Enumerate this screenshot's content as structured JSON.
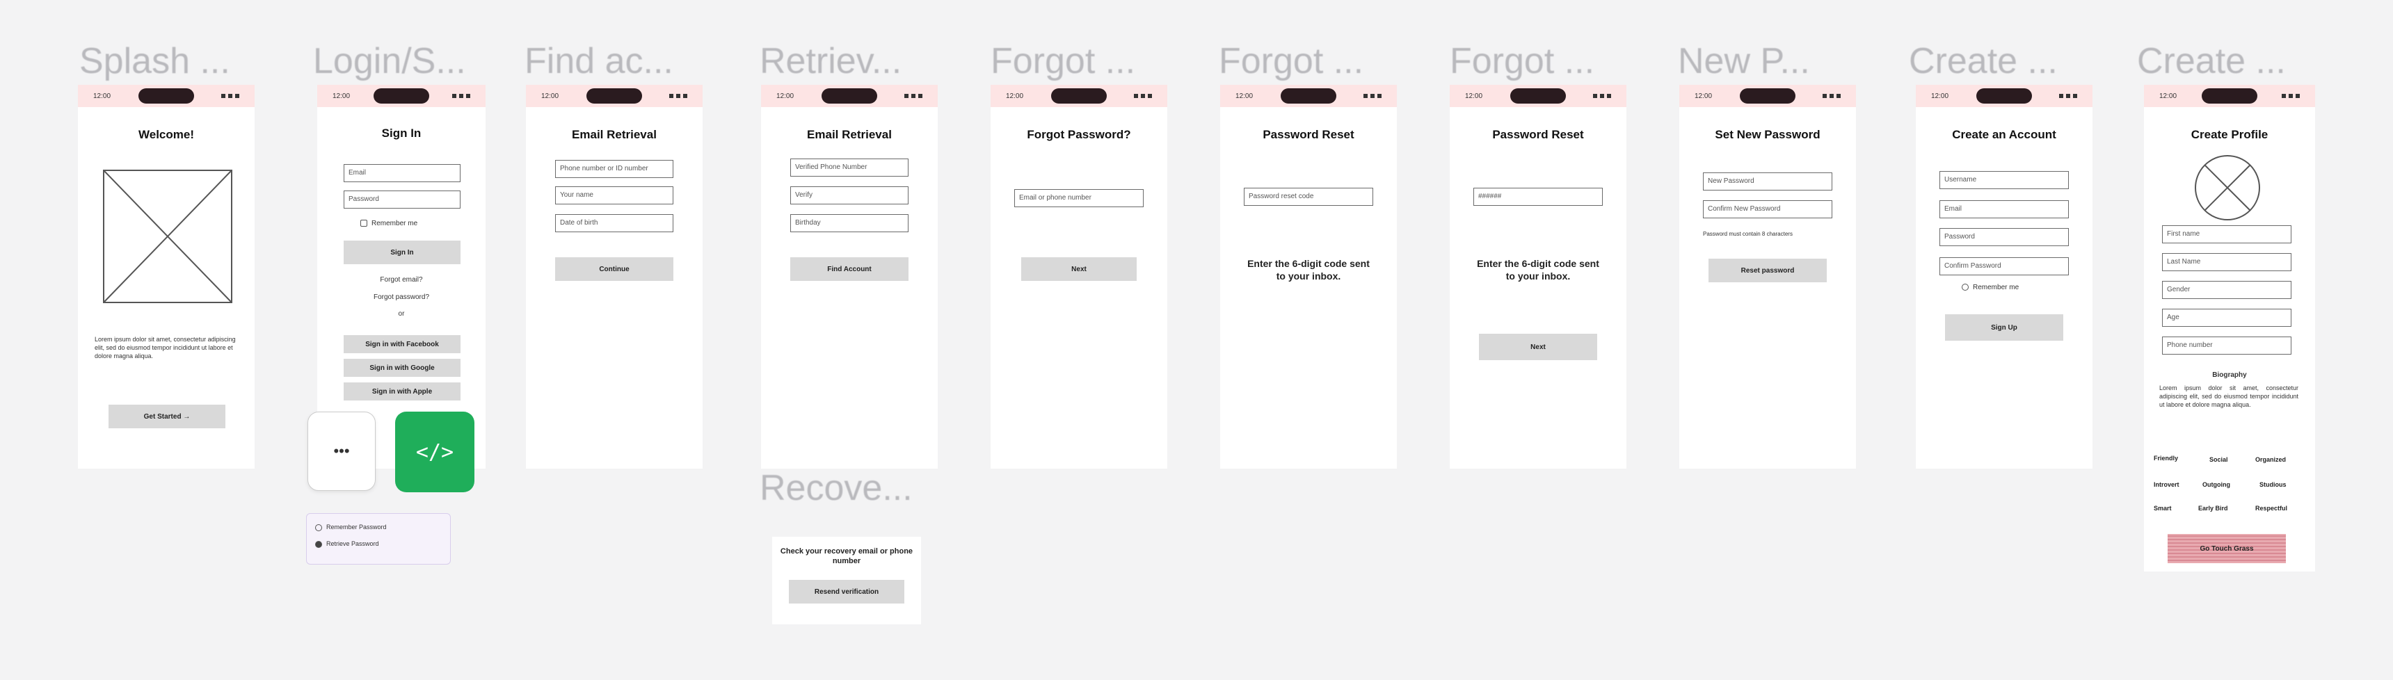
{
  "frames": {
    "splash": {
      "title": "Splash ...",
      "status_time": "12:00",
      "heading": "Welcome!",
      "body": "Lorem ipsum dolor sit amet, consectetur adipiscing elit, sed do eiusmod tempor incididunt ut labore et dolore magna aliqua.",
      "button": "Get Started →"
    },
    "login": {
      "title": "Login/S...",
      "status_time": "12:00",
      "heading": "Sign In",
      "email_placeholder": "Email",
      "password_placeholder": "Password",
      "remember_label": "Remember me",
      "signin_button": "Sign In",
      "forgot_link": "Forgot email?",
      "forgot_password_link": "Forgot password?",
      "or_label": "or",
      "facebook_button": "Sign in with Facebook",
      "google_button": "Sign in with Google",
      "apple_button": "Sign in with Apple",
      "popup_option_1": "Remember Password",
      "popup_option_2": "Retrieve Password",
      "dots_label": "•••",
      "code_label": "</>"
    },
    "find": {
      "title": "Find ac...",
      "status_time": "12:00",
      "heading": "Email Retrieval",
      "field1": "Phone number or ID number",
      "field2": "Your name",
      "field3": "Date of birth",
      "button": "Continue"
    },
    "retrieve": {
      "title": "Retriev...",
      "status_time": "12:00",
      "heading": "Email Retrieval",
      "field1": "Verified Phone Number",
      "field2": "Verify",
      "field3": "Birthday",
      "button": "Find Account"
    },
    "recover": {
      "title": "Recove...",
      "message": "Check your recovery email or phone number",
      "button": "Resend verification"
    },
    "forgot1": {
      "title": "Forgot ...",
      "status_time": "12:00",
      "heading": "Forgot Password?",
      "field": "Email or phone number",
      "button": "Next"
    },
    "forgot2": {
      "title": "Forgot ...",
      "status_time": "12:00",
      "heading": "Password Reset",
      "field": "Password reset code",
      "message": "Enter the 6-digit code sent to your inbox."
    },
    "forgot3": {
      "title": "Forgot ...",
      "status_time": "12:00",
      "heading": "Password Reset",
      "field": "######",
      "message": "Enter the 6-digit code sent to your inbox.",
      "button": "Next"
    },
    "newpass": {
      "title": "New P...",
      "status_time": "12:00",
      "heading": "Set New Password",
      "field1": "New Password",
      "field2": "Confirm New Password",
      "hint": "Password must contain 8 characters",
      "button": "Reset password"
    },
    "create1": {
      "title": "Create ...",
      "status_time": "12:00",
      "heading": "Create an Account",
      "field1": "Username",
      "field2": "Email",
      "field3": "Password",
      "field4": "Confirm Password",
      "checkbox": "Remember me",
      "button": "Sign Up"
    },
    "create2": {
      "title": "Create ...",
      "status_time": "12:00",
      "heading": "Create Profile",
      "field1": "First name",
      "field2": "Last Name",
      "field3": "Gender",
      "field4": "Age",
      "field5": "Phone number",
      "bio_heading": "Biography",
      "bio_text": "Lorem ipsum dolor sit amet, consectetur adipiscing elit, sed do eiusmod tempor incididunt ut labore et dolore magna aliqua.",
      "tags": [
        "Friendly",
        "Social",
        "Organized",
        "Introvert",
        "Outgoing",
        "Studious",
        "Smart",
        "Early Bird",
        "Respectful"
      ],
      "button": "Go Touch Grass"
    }
  }
}
